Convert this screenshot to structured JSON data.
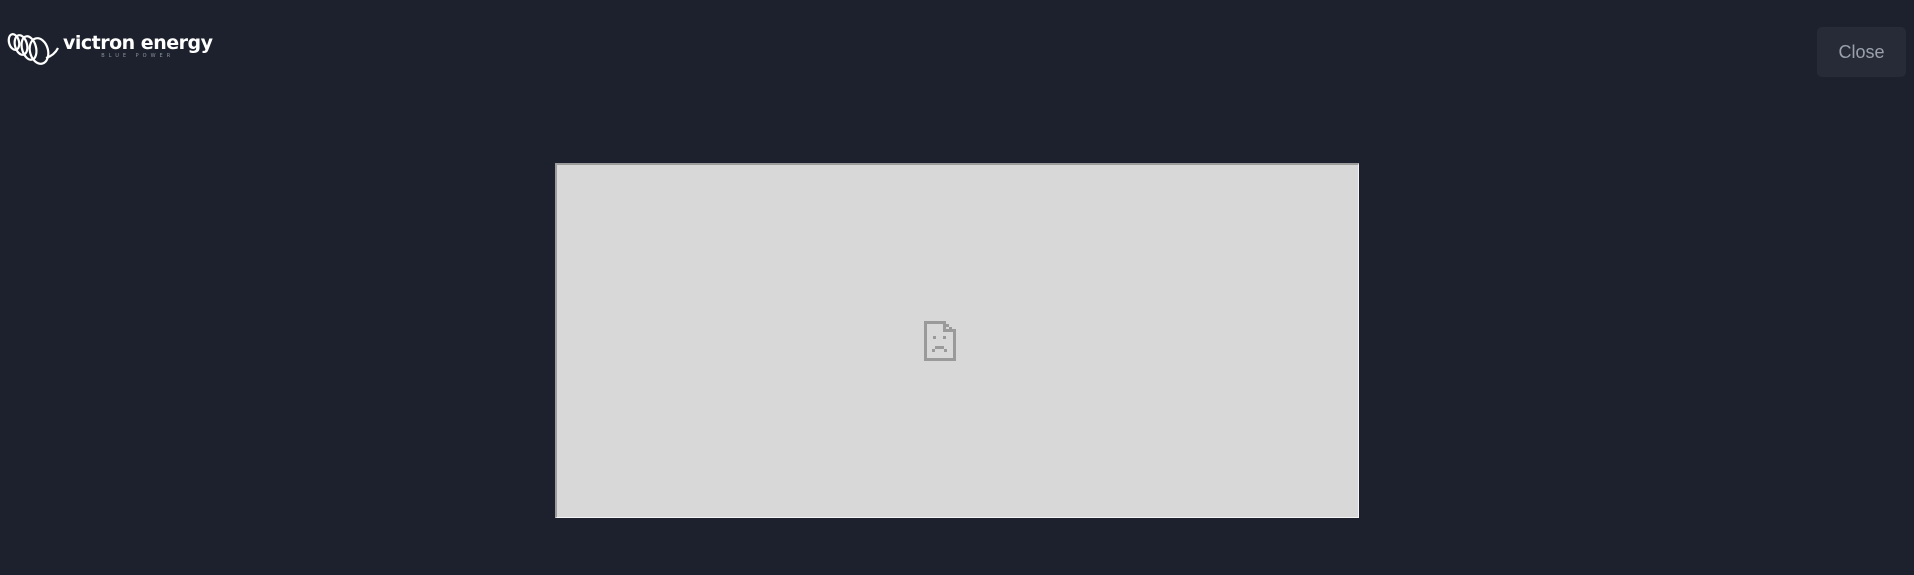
{
  "header": {
    "logo": {
      "name": "victron energy",
      "tagline": "BLUE POWER",
      "icon": "victron-spiral-logo"
    },
    "close_label": "Close"
  },
  "main": {
    "embedded_frame": {
      "state": "failed-to-load",
      "icon": "broken-page-icon"
    }
  },
  "colors": {
    "background": "#1c212d",
    "button_bg": "#262b37",
    "button_text": "#9aa0ac",
    "frame_bg": "#d8d8d8",
    "icon_gray": "#9a9a9a"
  }
}
